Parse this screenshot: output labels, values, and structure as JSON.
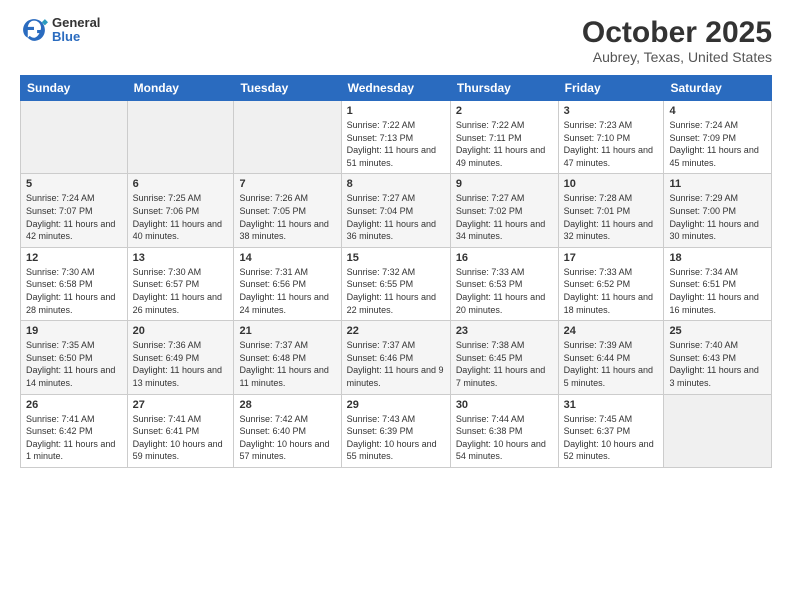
{
  "header": {
    "logo": {
      "general": "General",
      "blue": "Blue"
    },
    "title": "October 2025",
    "location": "Aubrey, Texas, United States"
  },
  "weekdays": [
    "Sunday",
    "Monday",
    "Tuesday",
    "Wednesday",
    "Thursday",
    "Friday",
    "Saturday"
  ],
  "weeks": [
    [
      {
        "day": "",
        "sunrise": "",
        "sunset": "",
        "daylight": ""
      },
      {
        "day": "",
        "sunrise": "",
        "sunset": "",
        "daylight": ""
      },
      {
        "day": "",
        "sunrise": "",
        "sunset": "",
        "daylight": ""
      },
      {
        "day": "1",
        "sunrise": "Sunrise: 7:22 AM",
        "sunset": "Sunset: 7:13 PM",
        "daylight": "Daylight: 11 hours and 51 minutes."
      },
      {
        "day": "2",
        "sunrise": "Sunrise: 7:22 AM",
        "sunset": "Sunset: 7:11 PM",
        "daylight": "Daylight: 11 hours and 49 minutes."
      },
      {
        "day": "3",
        "sunrise": "Sunrise: 7:23 AM",
        "sunset": "Sunset: 7:10 PM",
        "daylight": "Daylight: 11 hours and 47 minutes."
      },
      {
        "day": "4",
        "sunrise": "Sunrise: 7:24 AM",
        "sunset": "Sunset: 7:09 PM",
        "daylight": "Daylight: 11 hours and 45 minutes."
      }
    ],
    [
      {
        "day": "5",
        "sunrise": "Sunrise: 7:24 AM",
        "sunset": "Sunset: 7:07 PM",
        "daylight": "Daylight: 11 hours and 42 minutes."
      },
      {
        "day": "6",
        "sunrise": "Sunrise: 7:25 AM",
        "sunset": "Sunset: 7:06 PM",
        "daylight": "Daylight: 11 hours and 40 minutes."
      },
      {
        "day": "7",
        "sunrise": "Sunrise: 7:26 AM",
        "sunset": "Sunset: 7:05 PM",
        "daylight": "Daylight: 11 hours and 38 minutes."
      },
      {
        "day": "8",
        "sunrise": "Sunrise: 7:27 AM",
        "sunset": "Sunset: 7:04 PM",
        "daylight": "Daylight: 11 hours and 36 minutes."
      },
      {
        "day": "9",
        "sunrise": "Sunrise: 7:27 AM",
        "sunset": "Sunset: 7:02 PM",
        "daylight": "Daylight: 11 hours and 34 minutes."
      },
      {
        "day": "10",
        "sunrise": "Sunrise: 7:28 AM",
        "sunset": "Sunset: 7:01 PM",
        "daylight": "Daylight: 11 hours and 32 minutes."
      },
      {
        "day": "11",
        "sunrise": "Sunrise: 7:29 AM",
        "sunset": "Sunset: 7:00 PM",
        "daylight": "Daylight: 11 hours and 30 minutes."
      }
    ],
    [
      {
        "day": "12",
        "sunrise": "Sunrise: 7:30 AM",
        "sunset": "Sunset: 6:58 PM",
        "daylight": "Daylight: 11 hours and 28 minutes."
      },
      {
        "day": "13",
        "sunrise": "Sunrise: 7:30 AM",
        "sunset": "Sunset: 6:57 PM",
        "daylight": "Daylight: 11 hours and 26 minutes."
      },
      {
        "day": "14",
        "sunrise": "Sunrise: 7:31 AM",
        "sunset": "Sunset: 6:56 PM",
        "daylight": "Daylight: 11 hours and 24 minutes."
      },
      {
        "day": "15",
        "sunrise": "Sunrise: 7:32 AM",
        "sunset": "Sunset: 6:55 PM",
        "daylight": "Daylight: 11 hours and 22 minutes."
      },
      {
        "day": "16",
        "sunrise": "Sunrise: 7:33 AM",
        "sunset": "Sunset: 6:53 PM",
        "daylight": "Daylight: 11 hours and 20 minutes."
      },
      {
        "day": "17",
        "sunrise": "Sunrise: 7:33 AM",
        "sunset": "Sunset: 6:52 PM",
        "daylight": "Daylight: 11 hours and 18 minutes."
      },
      {
        "day": "18",
        "sunrise": "Sunrise: 7:34 AM",
        "sunset": "Sunset: 6:51 PM",
        "daylight": "Daylight: 11 hours and 16 minutes."
      }
    ],
    [
      {
        "day": "19",
        "sunrise": "Sunrise: 7:35 AM",
        "sunset": "Sunset: 6:50 PM",
        "daylight": "Daylight: 11 hours and 14 minutes."
      },
      {
        "day": "20",
        "sunrise": "Sunrise: 7:36 AM",
        "sunset": "Sunset: 6:49 PM",
        "daylight": "Daylight: 11 hours and 13 minutes."
      },
      {
        "day": "21",
        "sunrise": "Sunrise: 7:37 AM",
        "sunset": "Sunset: 6:48 PM",
        "daylight": "Daylight: 11 hours and 11 minutes."
      },
      {
        "day": "22",
        "sunrise": "Sunrise: 7:37 AM",
        "sunset": "Sunset: 6:46 PM",
        "daylight": "Daylight: 11 hours and 9 minutes."
      },
      {
        "day": "23",
        "sunrise": "Sunrise: 7:38 AM",
        "sunset": "Sunset: 6:45 PM",
        "daylight": "Daylight: 11 hours and 7 minutes."
      },
      {
        "day": "24",
        "sunrise": "Sunrise: 7:39 AM",
        "sunset": "Sunset: 6:44 PM",
        "daylight": "Daylight: 11 hours and 5 minutes."
      },
      {
        "day": "25",
        "sunrise": "Sunrise: 7:40 AM",
        "sunset": "Sunset: 6:43 PM",
        "daylight": "Daylight: 11 hours and 3 minutes."
      }
    ],
    [
      {
        "day": "26",
        "sunrise": "Sunrise: 7:41 AM",
        "sunset": "Sunset: 6:42 PM",
        "daylight": "Daylight: 11 hours and 1 minute."
      },
      {
        "day": "27",
        "sunrise": "Sunrise: 7:41 AM",
        "sunset": "Sunset: 6:41 PM",
        "daylight": "Daylight: 10 hours and 59 minutes."
      },
      {
        "day": "28",
        "sunrise": "Sunrise: 7:42 AM",
        "sunset": "Sunset: 6:40 PM",
        "daylight": "Daylight: 10 hours and 57 minutes."
      },
      {
        "day": "29",
        "sunrise": "Sunrise: 7:43 AM",
        "sunset": "Sunset: 6:39 PM",
        "daylight": "Daylight: 10 hours and 55 minutes."
      },
      {
        "day": "30",
        "sunrise": "Sunrise: 7:44 AM",
        "sunset": "Sunset: 6:38 PM",
        "daylight": "Daylight: 10 hours and 54 minutes."
      },
      {
        "day": "31",
        "sunrise": "Sunrise: 7:45 AM",
        "sunset": "Sunset: 6:37 PM",
        "daylight": "Daylight: 10 hours and 52 minutes."
      },
      {
        "day": "",
        "sunrise": "",
        "sunset": "",
        "daylight": ""
      }
    ]
  ]
}
